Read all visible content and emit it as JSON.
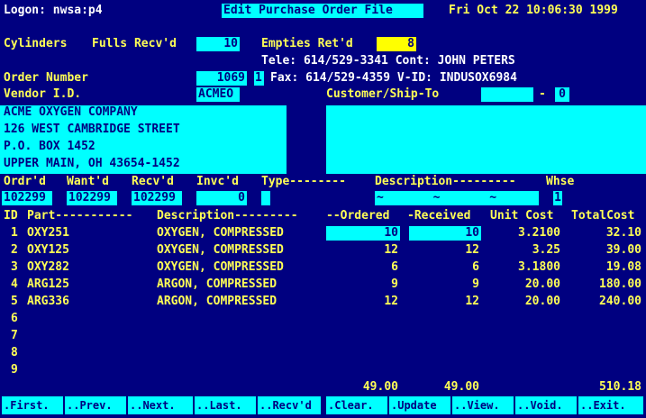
{
  "header": {
    "logon": "Logon: nwsa:p4",
    "title": "Edit Purchase Order File",
    "datetime": "Fri Oct 22 10:06:30 1999"
  },
  "cylinders": {
    "label": "Cylinders",
    "fulls_label": "Fulls Recv'd",
    "fulls_value": "10",
    "empties_label": "Empties Ret'd",
    "empties_value": "8"
  },
  "contact": {
    "tele": "Tele: 614/529-3341 Cont: JOHN PETERS",
    "fax": "Fax: 614/529-4359 V-ID: INDUSOX6984"
  },
  "order": {
    "number_label": "Order Number",
    "number_value": "1069",
    "suffix": "1",
    "vendor_label": "Vendor I.D.",
    "vendor_value": "ACMEO",
    "customer_label": "Customer/Ship-To",
    "customer_dash": "-",
    "customer_suffix": "0"
  },
  "vendor_address": [
    "ACME OXYGEN COMPANY",
    "126 WEST CAMBRIDGE STREET",
    "P.O. BOX 1452",
    "UPPER MAIN, OH 43654-1452"
  ],
  "dates": {
    "labels": {
      "ordrd": "Ordr'd",
      "wantd": "Want'd",
      "recvd": "Recv'd",
      "invcd": "Invc'd",
      "type": "Type--------",
      "description": "Description---------",
      "whse": "Whse"
    },
    "values": {
      "ordrd": "102299",
      "wantd": "102299",
      "recvd": "102299",
      "invcd": "0",
      "description": "~       ~       ~",
      "whse": "1"
    }
  },
  "table": {
    "headers": {
      "id": "ID",
      "part": "Part-----------",
      "description": "Description---------",
      "ordered": "--Ordered",
      "received": "-Received",
      "unit_cost": "Unit Cost",
      "total_cost": "TotalCost"
    },
    "rows": [
      {
        "id": "1",
        "part": "OXY251",
        "description": "OXYGEN, COMPRESSED",
        "ordered": "10",
        "received": "10",
        "unit_cost": "3.2100",
        "total": "32.10"
      },
      {
        "id": "2",
        "part": "OXY125",
        "description": "OXYGEN, COMPRESSED",
        "ordered": "12",
        "received": "12",
        "unit_cost": "3.25",
        "total": "39.00"
      },
      {
        "id": "3",
        "part": "OXY282",
        "description": "OXYGEN, COMPRESSED",
        "ordered": "6",
        "received": "6",
        "unit_cost": "3.1800",
        "total": "19.08"
      },
      {
        "id": "4",
        "part": "ARG125",
        "description": "ARGON, COMPRESSED",
        "ordered": "9",
        "received": "9",
        "unit_cost": "20.00",
        "total": "180.00"
      },
      {
        "id": "5",
        "part": "ARG336",
        "description": "ARGON, COMPRESSED",
        "ordered": "12",
        "received": "12",
        "unit_cost": "20.00",
        "total": "240.00"
      },
      {
        "id": "6",
        "part": "",
        "description": "",
        "ordered": "",
        "received": "",
        "unit_cost": "",
        "total": ""
      },
      {
        "id": "7",
        "part": "",
        "description": "",
        "ordered": "",
        "received": "",
        "unit_cost": "",
        "total": ""
      },
      {
        "id": "8",
        "part": "",
        "description": "",
        "ordered": "",
        "received": "",
        "unit_cost": "",
        "total": ""
      },
      {
        "id": "9",
        "part": "",
        "description": "",
        "ordered": "",
        "received": "",
        "unit_cost": "",
        "total": ""
      }
    ],
    "totals": {
      "ordered": "49.00",
      "received": "49.00",
      "total": "510.18"
    }
  },
  "function_keys": {
    "first": ".First.",
    "prev": "..Prev.",
    "next": "..Next.",
    "last": "..Last.",
    "recvd": "..Recv'd",
    "clear": ".Clear.",
    "update": ".Update",
    "view": "..View.",
    "void": "..Void.",
    "exit": "..Exit."
  }
}
